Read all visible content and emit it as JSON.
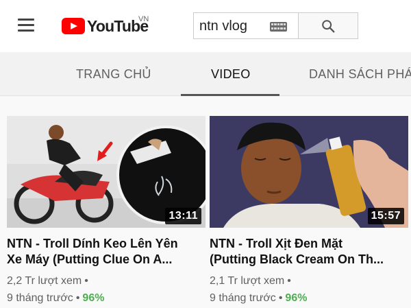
{
  "header": {
    "logo_text": "YouTube",
    "region": "VN",
    "search": {
      "value": "ntn vlog",
      "placeholder": ""
    }
  },
  "tabs": [
    {
      "label": "TRANG CHỦ",
      "active": false
    },
    {
      "label": "VIDEO",
      "active": true
    },
    {
      "label": "DANH SÁCH PHÁ",
      "active": false
    }
  ],
  "videos": [
    {
      "title_line1": "NTN - Troll Dính Keo Lên Yên",
      "title_line2": "Xe Máy (Putting Clue On A...",
      "duration": "13:11",
      "views": "2,2 Tr lượt xem",
      "separator": "•",
      "age": "9 tháng trước",
      "rating": "96%"
    },
    {
      "title_line1": "NTN - Troll Xịt Đen Mặt",
      "title_line2": "(Putting Black Cream On Th...",
      "duration": "15:57",
      "views": "2,1 Tr lượt xem",
      "separator": "•",
      "age": "9 tháng trước",
      "rating": "96%"
    }
  ],
  "colors": {
    "brand_red": "#ff0000",
    "rating_green": "#4caf50"
  },
  "icons": [
    "menu-icon",
    "youtube-play-icon",
    "keyboard-icon",
    "search-icon",
    "arrow-icon"
  ]
}
